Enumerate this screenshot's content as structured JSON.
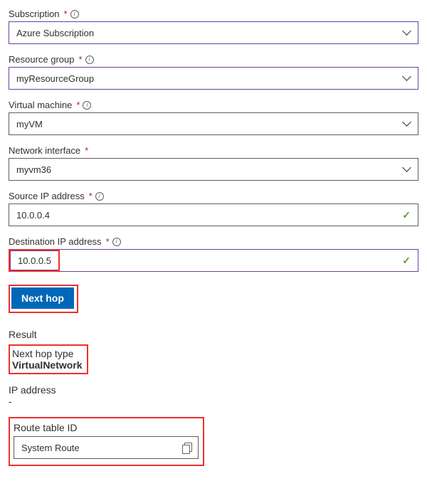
{
  "subscription": {
    "label": "Subscription",
    "value": "Azure Subscription"
  },
  "resourceGroup": {
    "label": "Resource group",
    "value": "myResourceGroup"
  },
  "virtualMachine": {
    "label": "Virtual machine",
    "value": "myVM"
  },
  "networkInterface": {
    "label": "Network interface",
    "value": "myvm36"
  },
  "sourceIp": {
    "label": "Source IP address",
    "value": "10.0.0.4"
  },
  "destIp": {
    "label": "Destination IP address",
    "value": "10.0.0.5"
  },
  "nexthopButton": "Next hop",
  "result": {
    "heading": "Result",
    "nhtLabel": "Next hop type",
    "nhtValue": "VirtualNetwork",
    "ipLabel": "IP address",
    "ipValue": "-",
    "routeLabel": "Route table ID",
    "routeValue": "System Route"
  }
}
